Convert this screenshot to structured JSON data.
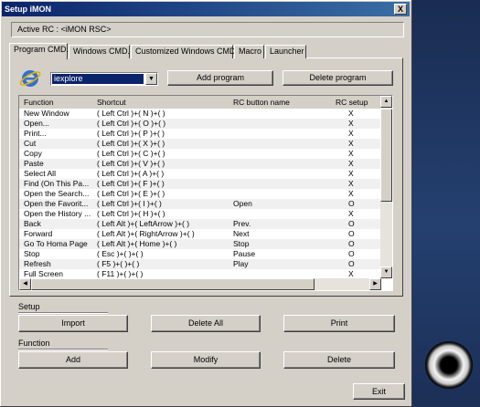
{
  "window": {
    "title": "Setup iMON",
    "close_label": "X"
  },
  "active_rc": "Active RC : <iMON RSC>",
  "tabs": [
    {
      "label": "Program CMD."
    },
    {
      "label": "Windows CMD."
    },
    {
      "label": "Customized Windows CMD."
    },
    {
      "label": "Macro"
    },
    {
      "label": "Launcher"
    }
  ],
  "program_select": {
    "value": "iexplore"
  },
  "buttons": {
    "add_program": "Add program",
    "delete_program": "Delete program",
    "import": "Import",
    "delete_all": "Delete All",
    "print": "Print",
    "add": "Add",
    "modify": "Modify",
    "delete": "Delete",
    "exit": "Exit"
  },
  "list": {
    "headers": [
      "Function",
      "Shortcut",
      "RC button name",
      "RC setup"
    ],
    "rows": [
      [
        "New Window",
        "( Left Ctrl )+( N )+( )",
        "",
        "X"
      ],
      [
        "Open...",
        "( Left Ctrl )+( O )+( )",
        "",
        "X"
      ],
      [
        "Print...",
        "( Left Ctrl )+( P )+( )",
        "",
        "X"
      ],
      [
        "Cut",
        "( Left Ctrl )+( X )+( )",
        "",
        "X"
      ],
      [
        "Copy",
        "( Left Ctrl )+( C )+( )",
        "",
        "X"
      ],
      [
        "Paste",
        "( Left Ctrl )+( V )+( )",
        "",
        "X"
      ],
      [
        "Select All",
        "( Left Ctrl )+( A )+( )",
        "",
        "X"
      ],
      [
        "Find (On This Pa...",
        "( Left Ctrl )+( F )+( )",
        "",
        "X"
      ],
      [
        "Open the Search...",
        "( Left Ctrl )+( E )+( )",
        "",
        "X"
      ],
      [
        "Open the Favorit...",
        "( Left Ctrl )+( I )+( )",
        "Open",
        "O"
      ],
      [
        "Open the History ...",
        "( Left Ctrl )+( H )+( )",
        "",
        "X"
      ],
      [
        "Back",
        "( Left Alt )+( LeftArrow )+( )",
        "Prev.",
        "O"
      ],
      [
        "Forward",
        "( Left Alt )+( RightArrow )+( )",
        "Next",
        "O"
      ],
      [
        "Go To Homa Page",
        "( Left Alt )+( Home )+( )",
        "Stop",
        "O"
      ],
      [
        "Stop",
        "( Esc )+( )+( )",
        "Pause",
        "O"
      ],
      [
        "Refresh",
        "( F5 )+( )+( )",
        "Play",
        "O"
      ],
      [
        "Full Screen",
        "( F11 )+( )+( )",
        "",
        "X"
      ]
    ]
  },
  "groups": {
    "setup": "Setup",
    "function": "Function"
  },
  "icons": {
    "app": "internet-explorer-icon",
    "speaker": "speaker-icon"
  }
}
